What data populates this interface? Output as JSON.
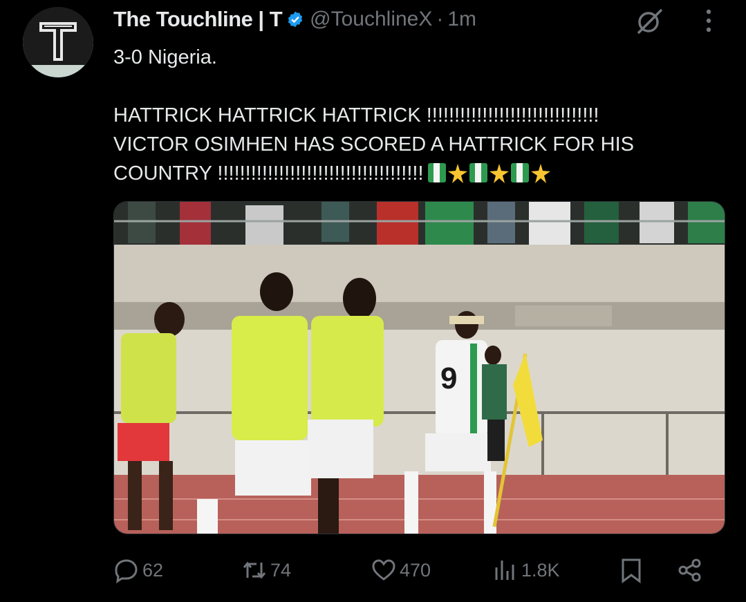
{
  "tweet": {
    "author_name": "The Touchline | T",
    "handle": "@TouchlineX",
    "separator": "·",
    "time": "1m",
    "line1": "3-0 Nigeria.",
    "line2": "HATTRICK HATTRICK HATTRICK !!!!!!!!!!!!!!!!!!!!!!!!!!!!!!!",
    "line3": "VICTOR OSIMHEN HAS SCORED A HATTRICK FOR HIS",
    "line4": "COUNTRY !!!!!!!!!!!!!!!!!!!!!!!!!!!!!!!!!!!!!",
    "emojis": [
      "nigeria-flag",
      "glowing-star",
      "nigeria-flag",
      "glowing-star",
      "nigeria-flag",
      "glowing-star"
    ],
    "media_type": "photo",
    "player_number": "9"
  },
  "actions": {
    "replies": "62",
    "reposts": "74",
    "likes": "470",
    "views": "1.8K"
  },
  "colors": {
    "background": "#000000",
    "text": "#e7e9ea",
    "muted": "#71767b",
    "verified": "#1d9bf0"
  }
}
